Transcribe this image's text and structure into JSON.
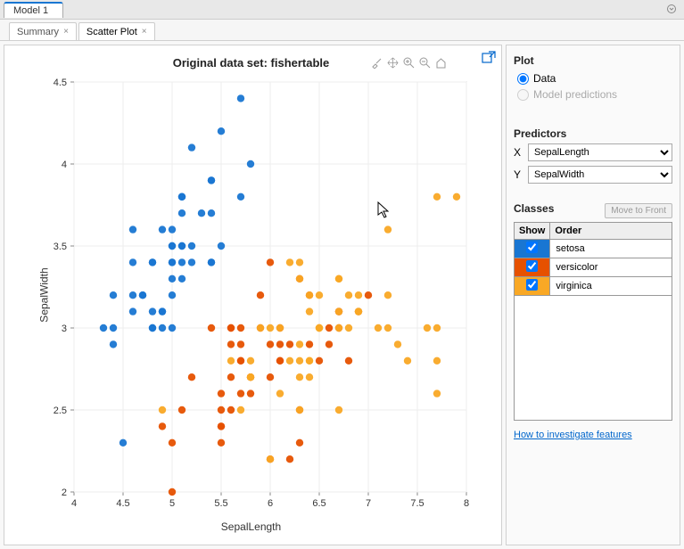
{
  "model_tab": "Model 1",
  "sub_tabs": [
    {
      "label": "Summary",
      "active": false
    },
    {
      "label": "Scatter Plot",
      "active": true
    }
  ],
  "chart_data": {
    "type": "scatter",
    "title": "Original data set: fishertable",
    "xlabel": "SepalLength",
    "ylabel": "SepalWidth",
    "xlim": [
      4,
      8
    ],
    "ylim": [
      2,
      4.5
    ],
    "xticks": [
      4,
      4.5,
      5,
      5.5,
      6,
      6.5,
      7,
      7.5,
      8
    ],
    "yticks": [
      2,
      2.5,
      3,
      3.5,
      4,
      4.5
    ],
    "series": [
      {
        "name": "setosa",
        "color": "#1976d2",
        "points": [
          [
            5.1,
            3.5
          ],
          [
            4.9,
            3.0
          ],
          [
            4.7,
            3.2
          ],
          [
            4.6,
            3.1
          ],
          [
            5.0,
            3.6
          ],
          [
            5.4,
            3.9
          ],
          [
            4.6,
            3.4
          ],
          [
            5.0,
            3.4
          ],
          [
            4.4,
            2.9
          ],
          [
            4.9,
            3.1
          ],
          [
            5.4,
            3.7
          ],
          [
            4.8,
            3.4
          ],
          [
            4.8,
            3.0
          ],
          [
            4.3,
            3.0
          ],
          [
            5.8,
            4.0
          ],
          [
            5.7,
            4.4
          ],
          [
            5.4,
            3.9
          ],
          [
            5.1,
            3.5
          ],
          [
            5.7,
            3.8
          ],
          [
            5.1,
            3.8
          ],
          [
            5.4,
            3.4
          ],
          [
            5.1,
            3.7
          ],
          [
            4.6,
            3.6
          ],
          [
            5.1,
            3.3
          ],
          [
            4.8,
            3.4
          ],
          [
            5.0,
            3.0
          ],
          [
            5.0,
            3.4
          ],
          [
            5.2,
            3.5
          ],
          [
            5.2,
            3.4
          ],
          [
            4.7,
            3.2
          ],
          [
            4.8,
            3.1
          ],
          [
            5.4,
            3.4
          ],
          [
            5.2,
            4.1
          ],
          [
            5.5,
            4.2
          ],
          [
            4.9,
            3.1
          ],
          [
            5.0,
            3.2
          ],
          [
            5.5,
            3.5
          ],
          [
            4.9,
            3.6
          ],
          [
            4.4,
            3.0
          ],
          [
            5.1,
            3.4
          ],
          [
            5.0,
            3.5
          ],
          [
            4.5,
            2.3
          ],
          [
            4.4,
            3.2
          ],
          [
            5.0,
            3.5
          ],
          [
            5.1,
            3.8
          ],
          [
            4.8,
            3.0
          ],
          [
            5.1,
            3.8
          ],
          [
            4.6,
            3.2
          ],
          [
            5.3,
            3.7
          ],
          [
            5.0,
            3.3
          ]
        ]
      },
      {
        "name": "versicolor",
        "color": "#e65100",
        "points": [
          [
            7.0,
            3.2
          ],
          [
            6.4,
            3.2
          ],
          [
            6.9,
            3.1
          ],
          [
            5.5,
            2.3
          ],
          [
            6.5,
            2.8
          ],
          [
            5.7,
            2.8
          ],
          [
            6.3,
            3.3
          ],
          [
            4.9,
            2.4
          ],
          [
            6.6,
            2.9
          ],
          [
            5.2,
            2.7
          ],
          [
            5.0,
            2.0
          ],
          [
            5.9,
            3.0
          ],
          [
            6.0,
            2.2
          ],
          [
            6.1,
            2.9
          ],
          [
            5.6,
            2.9
          ],
          [
            6.7,
            3.1
          ],
          [
            5.6,
            3.0
          ],
          [
            5.8,
            2.7
          ],
          [
            6.2,
            2.2
          ],
          [
            5.6,
            2.5
          ],
          [
            5.9,
            3.2
          ],
          [
            6.1,
            2.8
          ],
          [
            6.3,
            2.5
          ],
          [
            6.1,
            2.8
          ],
          [
            6.4,
            2.9
          ],
          [
            6.6,
            3.0
          ],
          [
            6.8,
            2.8
          ],
          [
            6.7,
            3.0
          ],
          [
            6.0,
            2.9
          ],
          [
            5.7,
            2.6
          ],
          [
            5.5,
            2.4
          ],
          [
            5.5,
            2.4
          ],
          [
            5.8,
            2.7
          ],
          [
            6.0,
            2.7
          ],
          [
            5.4,
            3.0
          ],
          [
            6.0,
            3.4
          ],
          [
            6.7,
            3.1
          ],
          [
            6.3,
            2.3
          ],
          [
            5.6,
            3.0
          ],
          [
            5.5,
            2.5
          ],
          [
            5.5,
            2.6
          ],
          [
            6.1,
            3.0
          ],
          [
            5.8,
            2.6
          ],
          [
            5.0,
            2.3
          ],
          [
            5.6,
            2.7
          ],
          [
            5.7,
            3.0
          ],
          [
            5.7,
            2.9
          ],
          [
            6.2,
            2.9
          ],
          [
            5.1,
            2.5
          ],
          [
            5.7,
            2.8
          ]
        ]
      },
      {
        "name": "virginica",
        "color": "#f9a825",
        "points": [
          [
            6.3,
            3.3
          ],
          [
            5.8,
            2.7
          ],
          [
            7.1,
            3.0
          ],
          [
            6.3,
            2.9
          ],
          [
            6.5,
            3.0
          ],
          [
            7.6,
            3.0
          ],
          [
            4.9,
            2.5
          ],
          [
            7.3,
            2.9
          ],
          [
            6.7,
            2.5
          ],
          [
            7.2,
            3.6
          ],
          [
            6.5,
            3.2
          ],
          [
            6.4,
            2.7
          ],
          [
            6.8,
            3.0
          ],
          [
            5.7,
            2.5
          ],
          [
            5.8,
            2.8
          ],
          [
            6.4,
            3.2
          ],
          [
            6.5,
            3.0
          ],
          [
            7.7,
            3.8
          ],
          [
            7.7,
            2.6
          ],
          [
            6.0,
            2.2
          ],
          [
            6.9,
            3.2
          ],
          [
            5.6,
            2.8
          ],
          [
            7.7,
            2.8
          ],
          [
            6.3,
            2.7
          ],
          [
            6.7,
            3.3
          ],
          [
            7.2,
            3.2
          ],
          [
            6.2,
            2.8
          ],
          [
            6.1,
            3.0
          ],
          [
            6.4,
            2.8
          ],
          [
            7.2,
            3.0
          ],
          [
            7.4,
            2.8
          ],
          [
            7.9,
            3.8
          ],
          [
            6.4,
            2.8
          ],
          [
            6.3,
            2.8
          ],
          [
            6.1,
            2.6
          ],
          [
            7.7,
            3.0
          ],
          [
            6.3,
            3.4
          ],
          [
            6.4,
            3.1
          ],
          [
            6.0,
            3.0
          ],
          [
            6.9,
            3.1
          ],
          [
            6.7,
            3.1
          ],
          [
            6.9,
            3.1
          ],
          [
            5.8,
            2.7
          ],
          [
            6.8,
            3.2
          ],
          [
            6.7,
            3.3
          ],
          [
            6.7,
            3.0
          ],
          [
            6.3,
            2.5
          ],
          [
            6.5,
            3.0
          ],
          [
            6.2,
            3.4
          ],
          [
            5.9,
            3.0
          ]
        ]
      }
    ]
  },
  "side": {
    "plot_label": "Plot",
    "radio_data": "Data",
    "radio_pred": "Model predictions",
    "predictors_label": "Predictors",
    "x_label": "X",
    "y_label": "Y",
    "x_value": "SepalLength",
    "y_value": "SepalWidth",
    "classes_label": "Classes",
    "move_btn": "Move to Front",
    "th_show": "Show",
    "th_order": "Order",
    "classes": [
      {
        "name": "setosa",
        "color": "#1976d2",
        "checked": true
      },
      {
        "name": "versicolor",
        "color": "#e65100",
        "checked": true
      },
      {
        "name": "virginica",
        "color": "#f9a825",
        "checked": true
      }
    ],
    "footer_link": "How to investigate features"
  }
}
